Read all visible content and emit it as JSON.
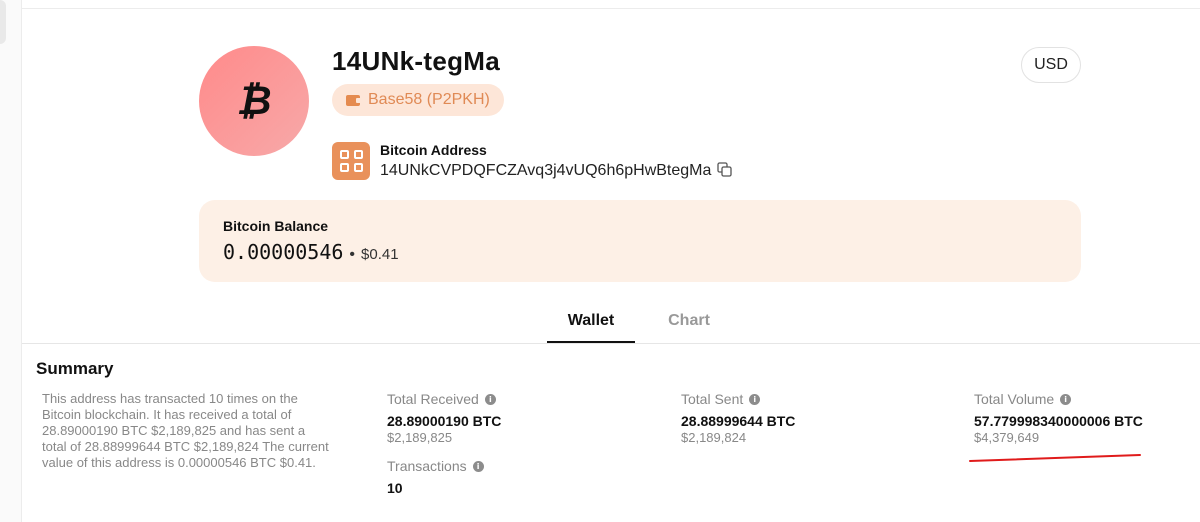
{
  "header": {
    "title": "14UNk-tegMa",
    "avatar_symbol": "₿",
    "address_type": "Base58 (P2PKH)",
    "currency_button": "USD"
  },
  "address": {
    "label": "Bitcoin Address",
    "value": "14UNkCVPDQFCZAvq3j4vUQ6h6pHwBtegMa"
  },
  "balance": {
    "label": "Bitcoin Balance",
    "btc": "0.00000546",
    "separator": "•",
    "usd": "$0.41"
  },
  "tabs": [
    {
      "label": "Wallet",
      "active": true
    },
    {
      "label": "Chart",
      "active": false
    }
  ],
  "summary": {
    "title": "Summary",
    "text": "This address has transacted 10 times on the Bitcoin blockchain. It has received a total of 28.89000190 BTC $2,189,825 and has sent a total of 28.88999644 BTC $2,189,824 The current value of this address is 0.00000546 BTC $0.41.",
    "total_received": {
      "label": "Total Received",
      "btc": "28.89000190 BTC",
      "usd": "$2,189,825"
    },
    "transactions": {
      "label": "Transactions",
      "value": "10"
    },
    "total_sent": {
      "label": "Total Sent",
      "btc": "28.88999644 BTC",
      "usd": "$2,189,824"
    },
    "total_volume": {
      "label": "Total Volume",
      "btc": "57.779998340000006 BTC",
      "usd": "$4,379,649"
    }
  },
  "colors": {
    "accent_orange": "#e9915b",
    "badge_bg": "#fde6d8",
    "card_bg": "#fdf0e6",
    "annotation_red": "#e01b1b"
  }
}
